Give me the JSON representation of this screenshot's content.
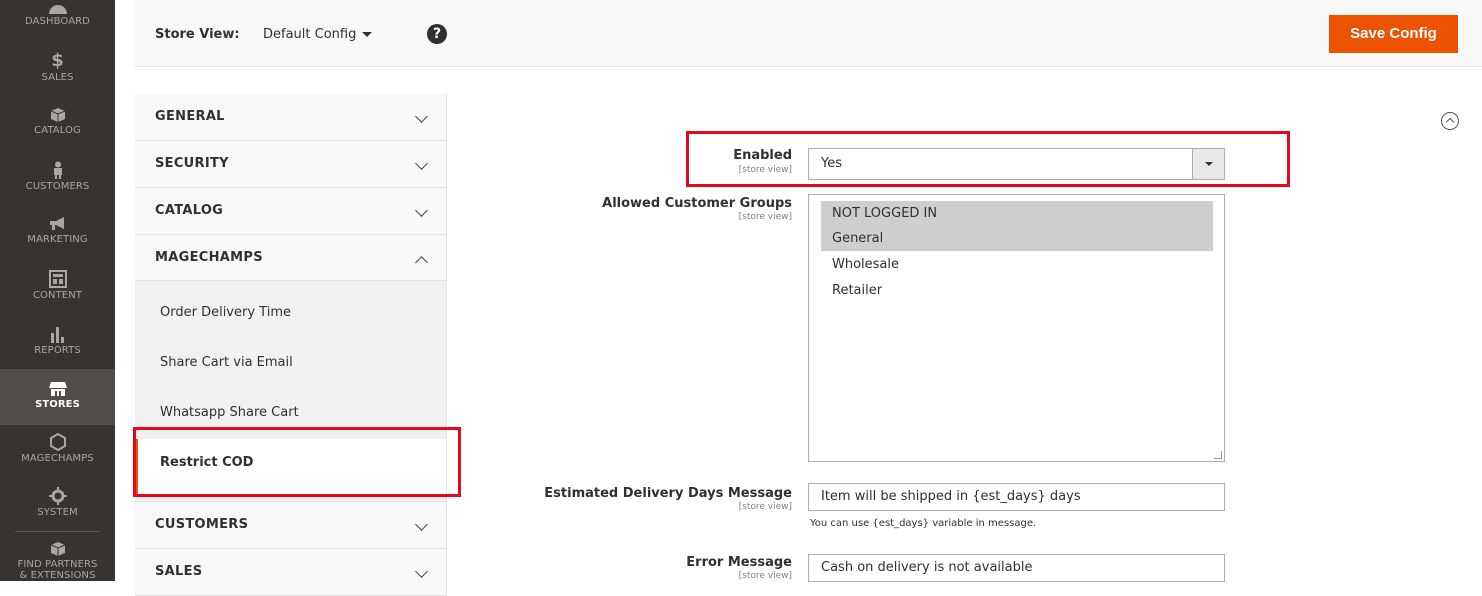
{
  "menu": {
    "items": [
      {
        "key": "dashboard",
        "label": "Dashboard",
        "icon": "dashboard-icon"
      },
      {
        "key": "sales",
        "label": "Sales",
        "icon": "dollar-icon"
      },
      {
        "key": "catalog",
        "label": "Catalog",
        "icon": "box-icon"
      },
      {
        "key": "customers",
        "label": "Customers",
        "icon": "person-icon"
      },
      {
        "key": "marketing",
        "label": "Marketing",
        "icon": "megaphone-icon"
      },
      {
        "key": "content",
        "label": "Content",
        "icon": "layout-icon"
      },
      {
        "key": "reports",
        "label": "Reports",
        "icon": "bar-chart-icon"
      },
      {
        "key": "stores",
        "label": "Stores",
        "icon": "store-icon"
      },
      {
        "key": "magechamps",
        "label": "MageChamps",
        "icon": "hexagon-icon"
      },
      {
        "key": "system",
        "label": "System",
        "icon": "gear-icon"
      },
      {
        "key": "partners",
        "label": "Find Partners",
        "label2": "& Extensions",
        "icon": "box-icon"
      }
    ],
    "active": "stores"
  },
  "header": {
    "store_view_label": "Store View:",
    "store_view_value": "Default Config",
    "help_symbol": "?",
    "save_label": "Save Config"
  },
  "tabs": {
    "general": "GENERAL",
    "security": "SECURITY",
    "catalog": "CATALOG",
    "magechamps": "MAGECHAMPS",
    "sub_items": [
      "Order Delivery Time",
      "Share Cart via Email",
      "Whatsapp Share Cart",
      "Restrict COD"
    ],
    "active_sub": "Restrict COD",
    "customers": "CUSTOMERS",
    "sales": "SALES"
  },
  "form": {
    "enabled": {
      "label": "Enabled",
      "scope": "[store view]",
      "value": "Yes"
    },
    "groups": {
      "label": "Allowed Customer Groups",
      "scope": "[store view]",
      "options": [
        "NOT LOGGED IN",
        "General",
        "Wholesale",
        "Retailer"
      ],
      "selected": [
        "NOT LOGGED IN",
        "General"
      ]
    },
    "delivery_msg": {
      "label": "Estimated Delivery Days Message",
      "scope": "[store view]",
      "value": "Item will be shipped in {est_days} days",
      "note": "You can use {est_days} variable in message."
    },
    "error_msg": {
      "label": "Error Message",
      "scope": "[store view]",
      "value": "Cash on delivery is not available"
    }
  },
  "colors": {
    "accent": "#eb5202",
    "menu_bg": "#373330",
    "highlight": "#e0091f"
  }
}
